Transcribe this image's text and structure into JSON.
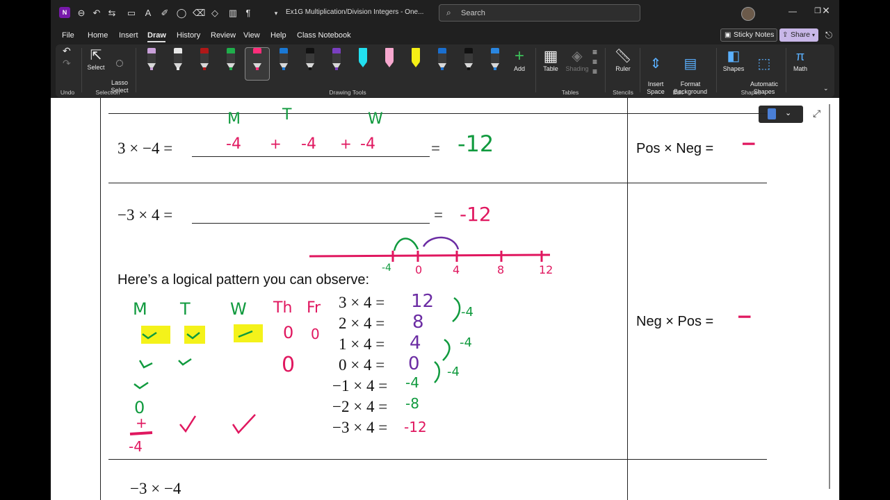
{
  "app": {
    "doc_title": "Ex1G Multiplication/Division Integers  -  One...",
    "search_placeholder": "Search",
    "logo_text": "N"
  },
  "menu": {
    "items": [
      "File",
      "Home",
      "Insert",
      "Draw",
      "History",
      "Review",
      "View",
      "Help",
      "Class Notebook"
    ],
    "active": "Draw",
    "sticky_notes": "Sticky Notes",
    "share": "Share"
  },
  "ribbon": {
    "undo_group": "Undo",
    "select": "Select",
    "lasso_select": "Lasso\nSelect",
    "selection_group": "Selection",
    "drawing_tools_group": "Drawing Tools",
    "add": "Add",
    "table": "Table",
    "shading": "Shading",
    "tables_group": "Tables",
    "ruler": "Ruler",
    "stencils_group": "Stencils",
    "insert_space": "Insert\nSpace",
    "format_background": "Format\nBackground",
    "edit_group": "Edit",
    "shapes": "Shapes",
    "automatic_shapes": "Automatic\nShapes",
    "shapes_group": "Shapes",
    "math": "Math",
    "pens": [
      {
        "name": "pencil",
        "color": "#c9a0d9"
      },
      {
        "name": "pen-white",
        "color": "#e8e8e8"
      },
      {
        "name": "pen-red",
        "color": "#b01818"
      },
      {
        "name": "pen-green",
        "color": "#1fae4b"
      },
      {
        "name": "pen-pink",
        "color": "#ff2d7a"
      },
      {
        "name": "pen-blue",
        "color": "#1a78d4"
      },
      {
        "name": "pen-black",
        "color": "#111111"
      },
      {
        "name": "pen-purple",
        "color": "#7a3fc0"
      },
      {
        "name": "highlighter-cyan",
        "color": "#22e0f0"
      },
      {
        "name": "highlighter-pink",
        "color": "#f7a8cf"
      },
      {
        "name": "highlighter-yellow",
        "color": "#f5ef15"
      },
      {
        "name": "pen-blue-2",
        "color": "#1a6fd0"
      },
      {
        "name": "pen-black-2",
        "color": "#111111"
      },
      {
        "name": "pen-blue-3",
        "color": "#2a86e0"
      }
    ]
  },
  "content": {
    "eq1_left": "3 × −4 =",
    "eq1_right": "=",
    "eq2_left": "−3 × 4 =",
    "eq2_right": "=",
    "pos_neg": "Pos × Neg =",
    "neg_pos": "Neg × Pos =",
    "pattern_heading": "Here’s a logical pattern you can observe:",
    "pattern": [
      "3 × 4 =",
      "2 × 4 =",
      "1 × 4 =",
      "0 × 4 =",
      "−1 × 4 =",
      "−2 × 4 =",
      "−3 × 4 ="
    ],
    "bottom_partial": "−3 × −4",
    "ink": {
      "eq1_terms": [
        "-4",
        "+",
        "-4",
        "+",
        "-4"
      ],
      "eq1_days": [
        "M",
        "T",
        "W"
      ],
      "eq1_answer": "-12",
      "eq2_answer": "-12",
      "pos_neg_answer": "−",
      "neg_pos_answer": "−",
      "numberline_ticks": [
        "-4",
        "0",
        "4",
        "8",
        "12"
      ],
      "pattern_answers": [
        "12",
        "8",
        "4",
        "0",
        "-4",
        "-8",
        "-12"
      ],
      "pattern_steps": [
        "-4",
        "-4",
        "-4"
      ],
      "days": [
        "M",
        "T",
        "W",
        "Th",
        "Fr"
      ],
      "left_col_bottom": [
        "0",
        "+",
        "-4"
      ],
      "zeros": [
        "0",
        "0",
        "0"
      ]
    }
  }
}
